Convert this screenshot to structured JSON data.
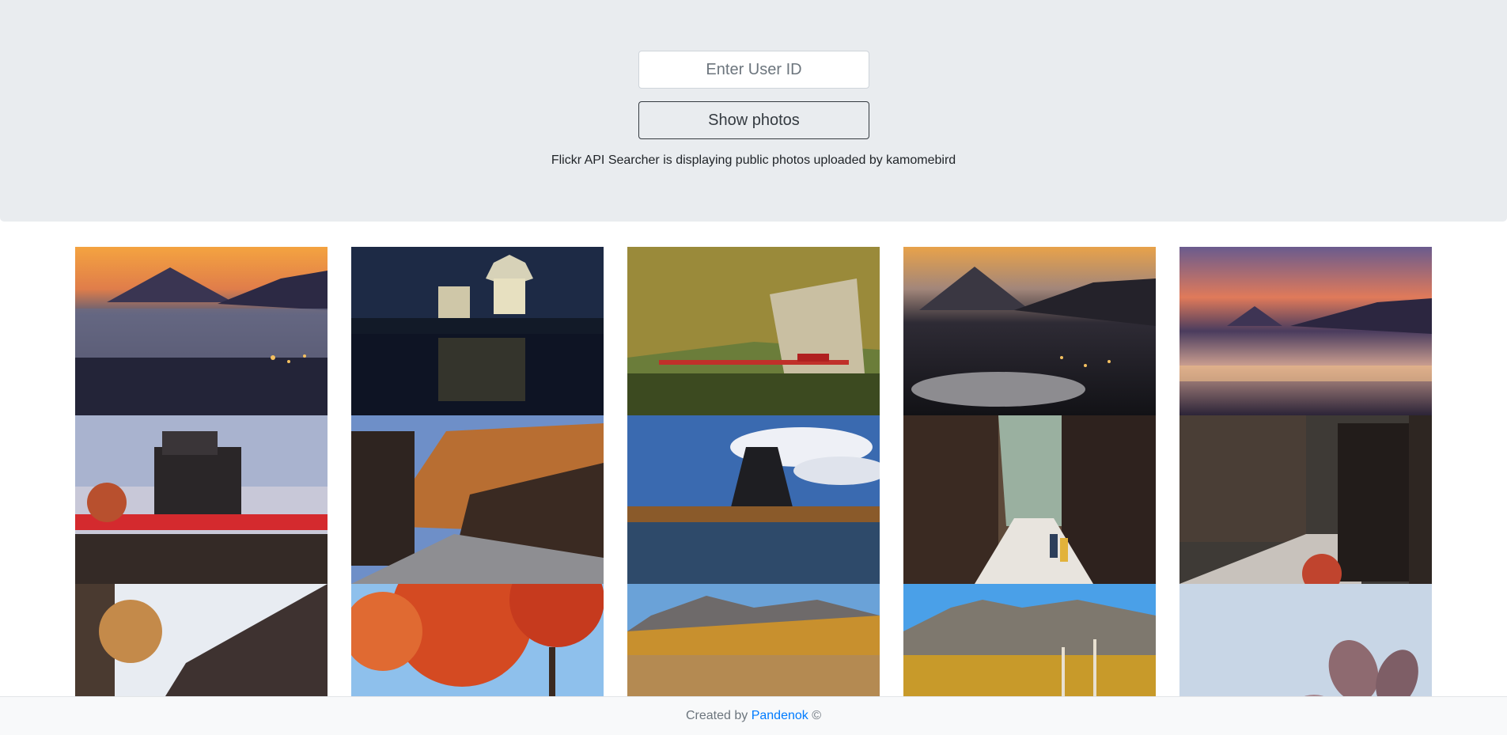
{
  "search": {
    "placeholder": "Enter User ID",
    "button_label": "Show photos",
    "status_text": "Flickr API Searcher is displaying public photos uploaded by kamomebird"
  },
  "gallery": {
    "photos": [
      {
        "subject": "Mount Fuji above sea of clouds at dusk"
      },
      {
        "subject": "Matsumoto Castle illuminated at night with reflection"
      },
      {
        "subject": "Red railway bridge in autumn gorge"
      },
      {
        "subject": "Mount Fuji over city lights and lake at dusk"
      },
      {
        "subject": "Mount Fuji over glowing city fog at twilight"
      },
      {
        "subject": "Matsumoto Castle with red bridge"
      },
      {
        "subject": "Post town street with autumn mountains"
      },
      {
        "subject": "Matsumoto Castle under blue sky with reflection"
      },
      {
        "subject": "Post town street with people walking"
      },
      {
        "subject": "Wooden soba shop sign in post town"
      },
      {
        "subject": "Old wooden houses with autumn tree"
      },
      {
        "subject": "Red autumn maple leaves against sky"
      },
      {
        "subject": "Golden grassland with mountains"
      },
      {
        "subject": "Rocky peaks with yellow autumn birches"
      },
      {
        "subject": "Frost-covered leaves"
      }
    ]
  },
  "footer": {
    "prefix": "Created by ",
    "author_link": "Pandenok",
    "suffix": " ©"
  }
}
